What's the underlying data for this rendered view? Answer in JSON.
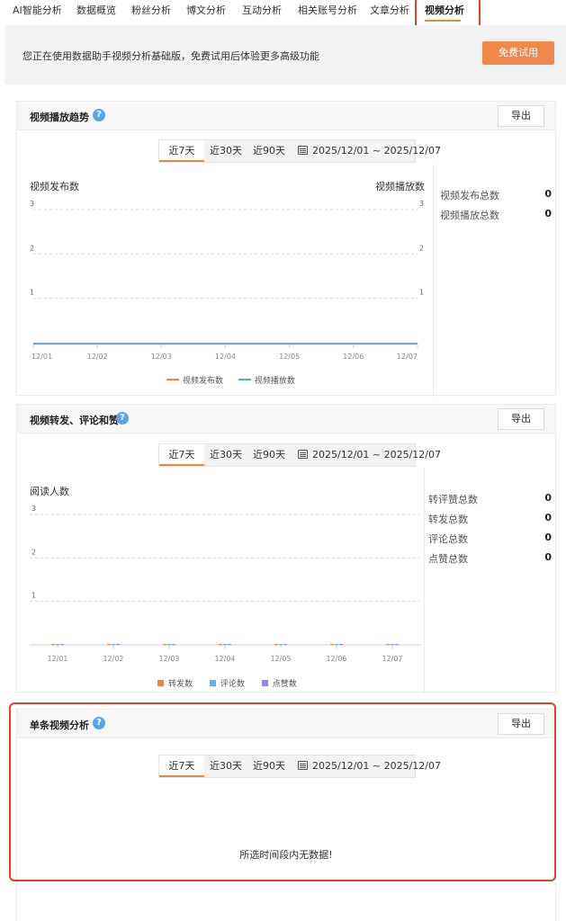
{
  "nav": {
    "tabs": [
      "AI智能分析",
      "数据概览",
      "粉丝分析",
      "博文分析",
      "互动分析",
      "相关账号分析",
      "文章分析",
      "视频分析"
    ],
    "active": "视频分析"
  },
  "banner": {
    "message": "您正在使用数据助手视频分析基础版，免费试用后体验更多高级功能",
    "trial_button": "免费试用"
  },
  "range": {
    "options": [
      "近7天",
      "近30天",
      "近90天"
    ],
    "selected": "近7天",
    "date_range": "2025/12/01 ~ 2025/12/07"
  },
  "export_label": "导出",
  "help_glyph": "?",
  "colors": {
    "accent": "#f0883a",
    "help": "#5aa5e9",
    "line_orange": "#f0883a",
    "line_blue": "#5aa5e9",
    "bar_orange": "#f0883a",
    "bar_blue": "#5ab5e8",
    "bar_purple": "#8a8af0",
    "highlight": "#e0412f"
  },
  "panel1": {
    "title": "视频播放趋势",
    "left_axis_title": "视频发布数",
    "right_axis_title": "视频播放数",
    "stats": [
      {
        "label": "视频发布总数",
        "value": "0"
      },
      {
        "label": "视频播放总数",
        "value": "0"
      }
    ],
    "legend": [
      "视频发布数",
      "视频播放数"
    ]
  },
  "panel2": {
    "title": "视频转发、评论和赞",
    "axis_title": "阅读人数",
    "stats": [
      {
        "label": "转评赞总数",
        "value": "0"
      },
      {
        "label": "转发总数",
        "value": "0"
      },
      {
        "label": "评论总数",
        "value": "0"
      },
      {
        "label": "点赞总数",
        "value": "0"
      }
    ],
    "legend": [
      "转发数",
      "评论数",
      "点赞数"
    ]
  },
  "panel3": {
    "title": "单条视频分析",
    "empty_message": "所选时间段内无数据!"
  },
  "chart_data": [
    {
      "type": "line",
      "x": [
        "12/01",
        "12/02",
        "12/03",
        "12/04",
        "12/05",
        "12/06",
        "12/07"
      ],
      "series": [
        {
          "name": "视频发布数",
          "values": [
            0,
            0,
            0,
            0,
            0,
            0,
            0
          ]
        },
        {
          "name": "视频播放数",
          "values": [
            0,
            0,
            0,
            0,
            0,
            0,
            0
          ]
        }
      ],
      "y_ticks": [
        "1",
        "2",
        "3"
      ],
      "y2_ticks": [
        "1",
        "2",
        "3"
      ],
      "ylim": [
        0,
        3
      ],
      "ylabel": "视频发布数",
      "y2label": "视频播放数",
      "legend_position": "bottom",
      "grid": true
    },
    {
      "type": "bar",
      "categories": [
        "12/01",
        "12/02",
        "12/03",
        "12/04",
        "12/05",
        "12/06",
        "12/07"
      ],
      "series": [
        {
          "name": "转发数",
          "values": [
            0,
            0,
            0,
            0,
            0,
            0,
            0
          ]
        },
        {
          "name": "评论数",
          "values": [
            0,
            0,
            0,
            0,
            0,
            0,
            0
          ]
        },
        {
          "name": "点赞数",
          "values": [
            0,
            0,
            0,
            0,
            0,
            0,
            0
          ]
        }
      ],
      "y_ticks": [
        "1",
        "2",
        "3"
      ],
      "ylim": [
        0,
        3
      ],
      "ylabel": "阅读人数",
      "legend_position": "bottom",
      "grid": true
    }
  ]
}
